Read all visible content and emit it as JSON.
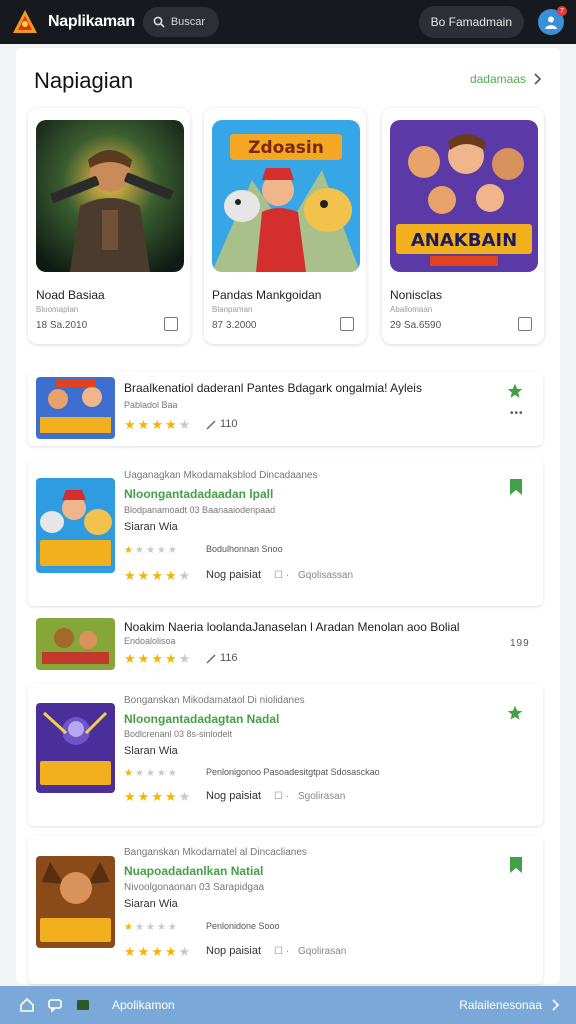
{
  "header": {
    "title": "Naplikaman",
    "search_label": "Buscar",
    "user_label": "Bo Famadmain",
    "notif_count": "7"
  },
  "section": {
    "title": "Napiagian",
    "see_all": "dadamaas"
  },
  "cards": [
    {
      "name": "Noad Basiaa",
      "sub": "Bloomaplan",
      "meta": "18 Sa.2010"
    },
    {
      "name": "Pandas Mankgoidan",
      "sub": "Blanpaman",
      "meta": "87 3.2000"
    },
    {
      "name": "Nonisclas",
      "sub": "Aballomaan",
      "meta": "29 Sa.6590"
    }
  ],
  "list": [
    {
      "title": "Braalkenatiol daderanl Pantes Bdagark ongalmia! Ayleis",
      "sub": "Pabladol Baa",
      "rating": 4,
      "count": "110"
    },
    {
      "header": "Uaganagkan Mkodamaksblod Dincadaanes",
      "green": "Nloongantadadaadan lpall",
      "sub": "Blodpanamoadt 03 Baanaaiodenpaad",
      "name": "Siaran Wia",
      "small_rating": 1,
      "small_text": "Bodulhonnan Snoo",
      "rating": 4,
      "note": "Nog paisiat",
      "extra": "Gqolisassan"
    },
    {
      "title": "Noakim Naeria loolandaJanaselan l Aradan Menolan aoo Bolial",
      "sub": "Endoalolisoa",
      "rating": 4,
      "count": "116",
      "dots": "199"
    },
    {
      "header": "Bonganskan Mikodamataol Di niolidanes",
      "green": "Nloongantadadagtan Nadal",
      "sub": "Bodlcrenanl 03 8s-sinlodelt",
      "name": "Slaran Wia",
      "small_rating": 1,
      "small_text": "Penlonigonoo Pasoadesitgtpat Sdosasckao",
      "rating": 4,
      "note": "Nog paisiat",
      "extra": "Sgolirasan"
    },
    {
      "header": "Banganskan Mkodamatel al Dincaclianes",
      "green": "Nuapoadadanlkan Natial",
      "sub": "Nivoolgonaonan 03 Sarapidgaa",
      "name": "Siaran Wia",
      "small_rating": 1,
      "small_text": "Penlonidone Sooo",
      "rating": 4,
      "note": "Nop paisiat",
      "extra": "Gqolirasan"
    }
  ],
  "bottom": {
    "label": "Apolikamon",
    "right": "Ralailenesonaa"
  },
  "colors": {
    "accent": "#4caf50",
    "topbar": "#16191d",
    "bottombar": "#7aa9d9",
    "star": "#f5b400"
  }
}
